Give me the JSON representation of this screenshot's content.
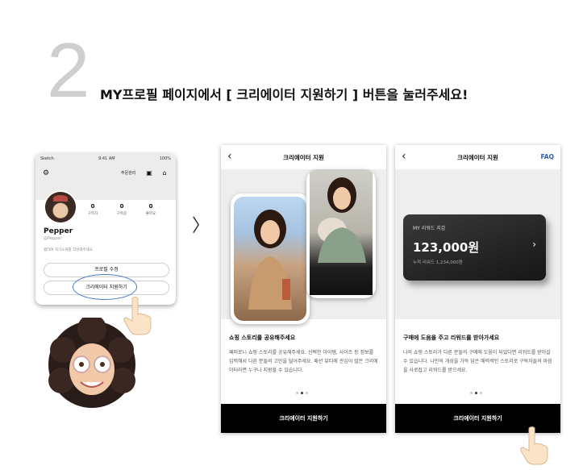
{
  "header": {
    "step_number": "2",
    "instruction": "MY프로필 페이지에서 [ 크리에이터 지원하기 ] 버튼을 눌러주세요!"
  },
  "profile_screen": {
    "status_carrier": "Sketch",
    "status_time": "9:41 AM",
    "status_battery": "100%",
    "order_manage_label": "주문관리",
    "user_name": "Pepper",
    "user_handle": "@Pepper",
    "intro_placeholder": "탭하여 자기소개를 작성해주세요",
    "stats": [
      {
        "value": "0",
        "label": "구독자"
      },
      {
        "value": "0",
        "label": "구독중"
      },
      {
        "value": "0",
        "label": "좋아요"
      }
    ],
    "edit_profile_label": "프로필 수정",
    "apply_creator_label": "크리에이터 지원하기"
  },
  "screen_share": {
    "title": "크리에이터 지원",
    "heading": "쇼핑 스토리를 공유해주세요",
    "body": "페퍼로니 쇼핑 스토리를 공유해주세요. 선택한 아이템, 사이즈 등 정보를 입력해서 다른 분들의 고민을 덜어주세요. 패션 뷰티에 관심이 많은 크리에이터라면 누구나 지원할 수 있습니다.",
    "button_label": "크리에이터 지원하기"
  },
  "screen_reward": {
    "title": "크리에이터 지원",
    "faq_label": "FAQ",
    "card_label": "MY 리워드 지갑",
    "card_amount": "123,000원",
    "card_cumulative": "누적 리워드  1,234,000원",
    "heading": "구매에 도움을 주고 리워드를 받아가세요",
    "body": "나의 쇼핑 스토리가 다른 분들의 구매에 도움이 되었다면 리워드를 받아갈 수 있습니다. 나만의 개성을 가득 담은 매력적인 스토리로 구독자들의 마음을 사로잡고 리워드를 받으세요.",
    "button_label": "크리에이터 지원하기"
  },
  "icons": {
    "back": "back-chevron-icon",
    "gear": "gear-icon",
    "next": "chevron-right-icon"
  }
}
